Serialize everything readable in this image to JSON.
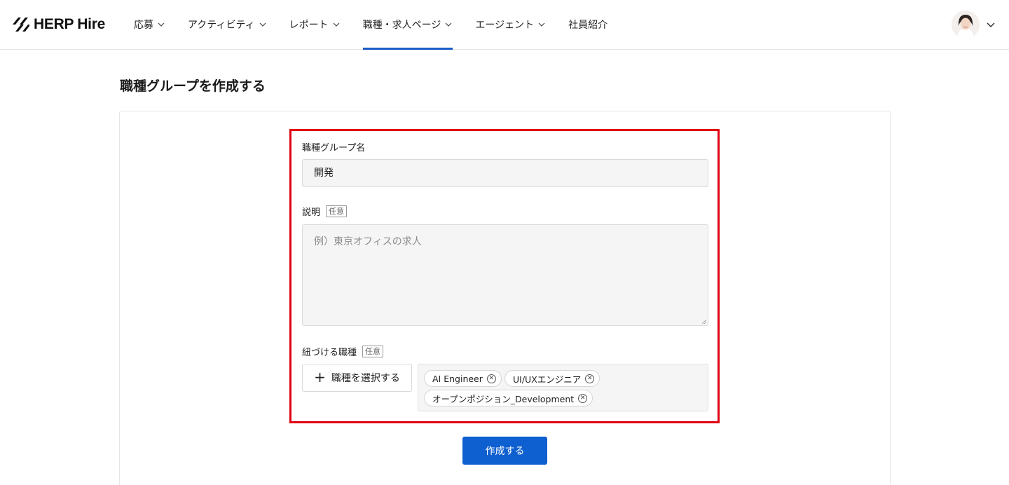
{
  "brand": {
    "logo_text": "HERP Hire",
    "accent": "#1a5bc8",
    "danger_outline": "#e00012",
    "primary_button": "#0e5fd0"
  },
  "nav": {
    "items": [
      {
        "label": "応募",
        "dropdown": true
      },
      {
        "label": "アクティビティ",
        "dropdown": true
      },
      {
        "label": "レポート",
        "dropdown": true
      },
      {
        "label": "職種・求人ページ",
        "dropdown": true,
        "active": true
      },
      {
        "label": "エージェント",
        "dropdown": true
      },
      {
        "label": "社員紹介",
        "dropdown": false
      }
    ]
  },
  "page": {
    "title": "職種グループを作成する"
  },
  "form": {
    "name_label": "職種グループ名",
    "name_value": "開発",
    "description_label": "説明",
    "optional_badge": "任意",
    "description_placeholder": "例）東京オフィスの求人",
    "positions_label": "紐づける職種",
    "select_button": "職種を選択する",
    "tags": [
      "AI Engineer",
      "UI/UXエンジニア",
      "オープンポジション_Development"
    ],
    "submit": "作成する"
  }
}
